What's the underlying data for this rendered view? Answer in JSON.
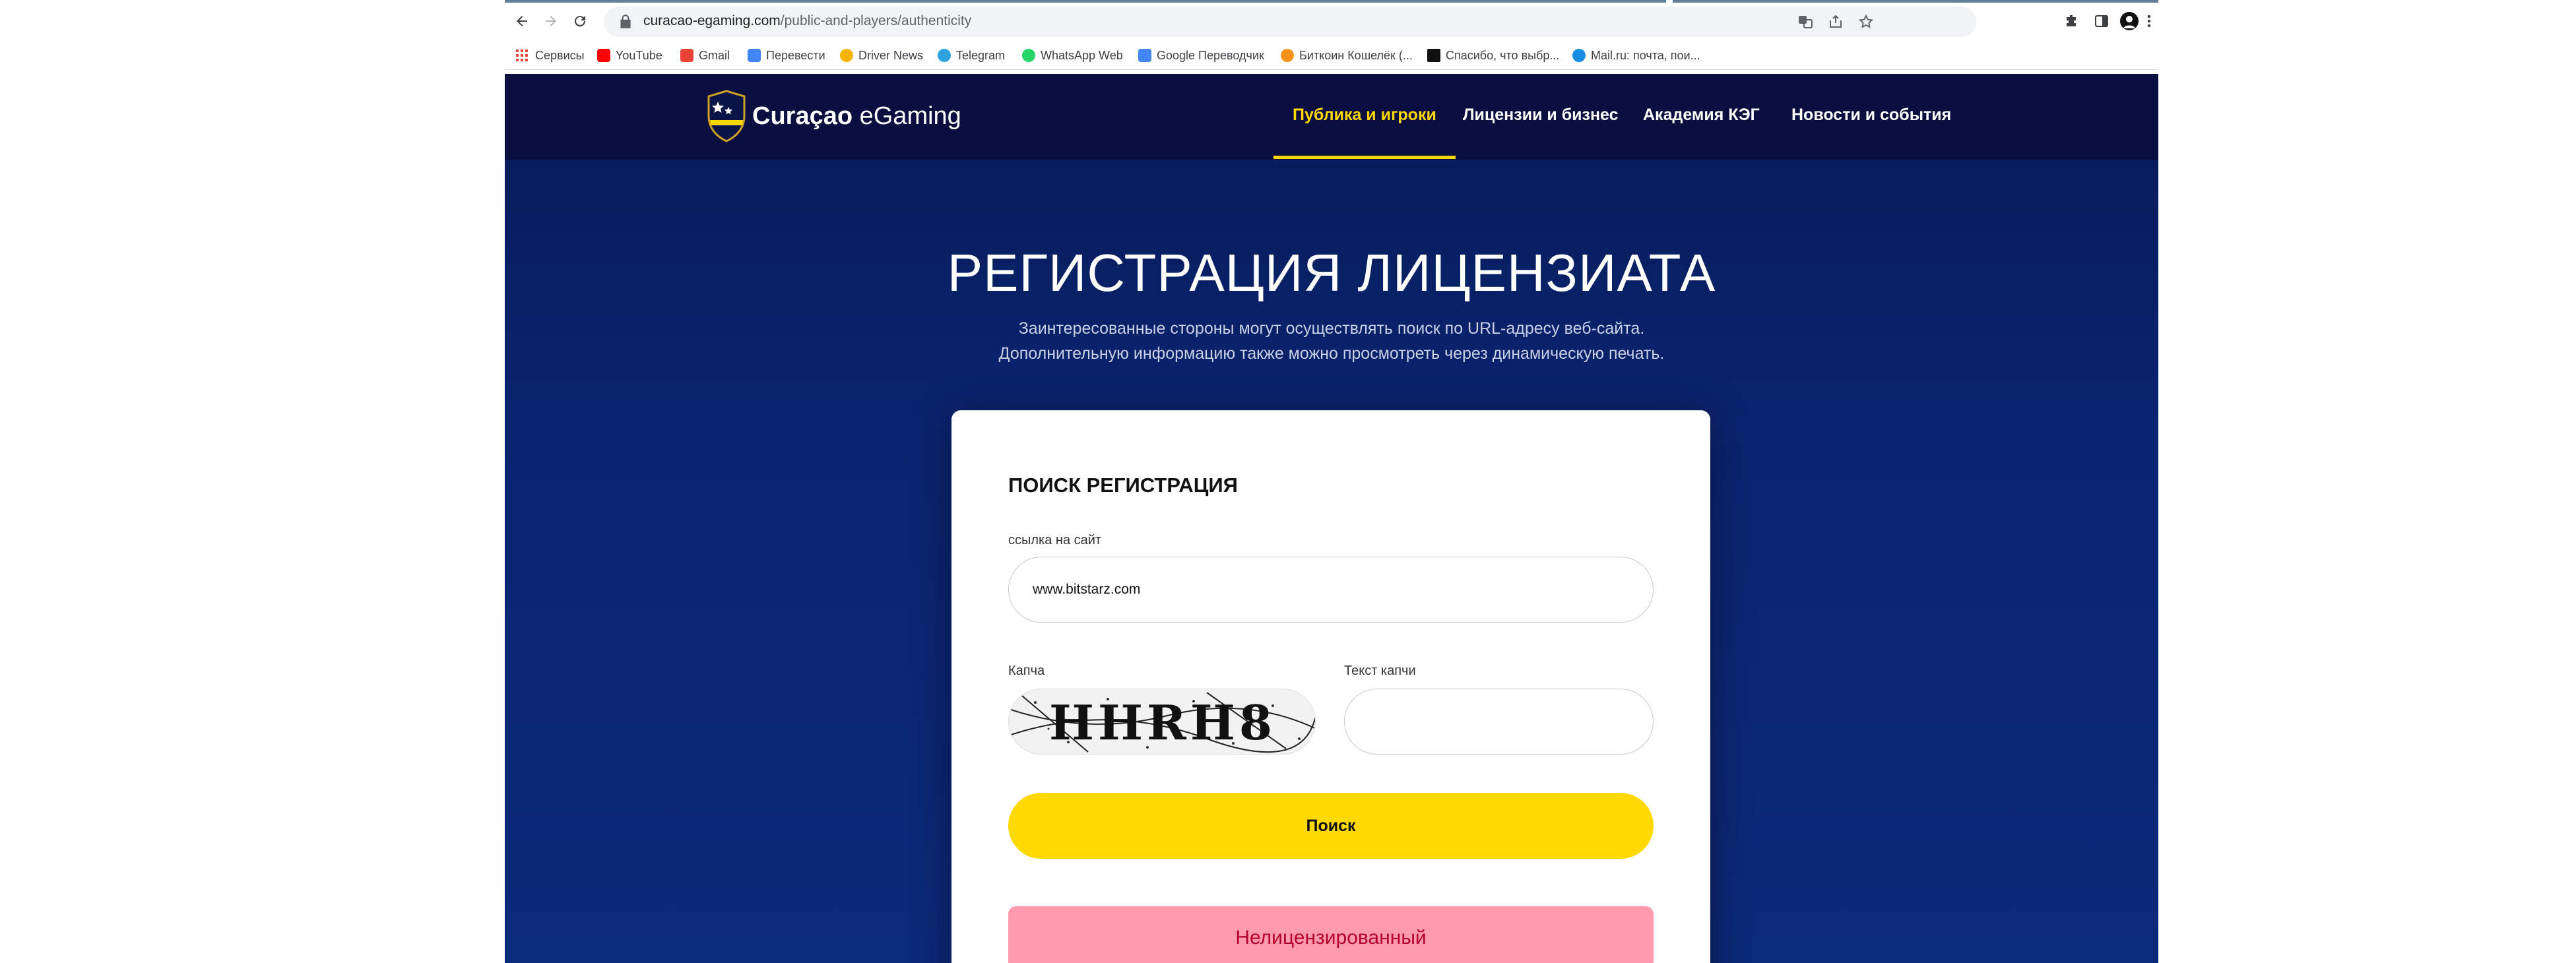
{
  "browser": {
    "url_host": "curacao-egaming.com",
    "url_path": "/public-and-players/authenticity",
    "bookmarks": [
      {
        "label": "Сервисы",
        "color": "#e8453c"
      },
      {
        "label": "YouTube",
        "color": "#ff0000"
      },
      {
        "label": "Gmail",
        "color": "#ea4335"
      },
      {
        "label": "Перевести",
        "color": "#4285f4"
      },
      {
        "label": "Driver News",
        "color": "#f4b400"
      },
      {
        "label": "Telegram",
        "color": "#2aa3df"
      },
      {
        "label": "WhatsApp Web",
        "color": "#25d366"
      },
      {
        "label": "Google Переводчик",
        "color": "#4285f4"
      },
      {
        "label": "Биткоин Кошелёк (...",
        "color": "#f7931a"
      },
      {
        "label": "Спасибо, что выбр...",
        "color": "#111111"
      },
      {
        "label": "Mail.ru: почта, пои...",
        "color": "#168de2"
      }
    ]
  },
  "site": {
    "logo_bold": "Curaçao",
    "logo_rest": " eGaming",
    "nav": [
      {
        "label": "Публика и игроки",
        "active": true
      },
      {
        "label": "Лицензии и бизнес",
        "active": false
      },
      {
        "label": "Академия КЭГ",
        "active": false
      },
      {
        "label": "Новости и события",
        "active": false
      }
    ],
    "hero_title": "РЕГИСТРАЦИЯ ЛИЦЕНЗИАТА",
    "hero_sub_1": "Заинтересованные стороны могут осуществлять поиск по URL-адресу веб-сайта.",
    "hero_sub_2": "Дополнительную информацию также можно просмотреть через динамическую печать."
  },
  "form": {
    "title": "ПОИСК РЕГИСТРАЦИЯ",
    "url_label": "ссылка на сайт",
    "url_value": "www.bitstarz.com",
    "captcha_label": "Капча",
    "captcha_code": "HHRH8",
    "captcha_text_label": "Текст капчи",
    "captcha_text_value": "",
    "search_button": "Поиск",
    "result": "Нелицензированный"
  },
  "colors": {
    "accent": "#ffd700",
    "header_bg": "#0b0f3f",
    "result_bg": "#ff9aae",
    "result_text": "#b5002a"
  }
}
